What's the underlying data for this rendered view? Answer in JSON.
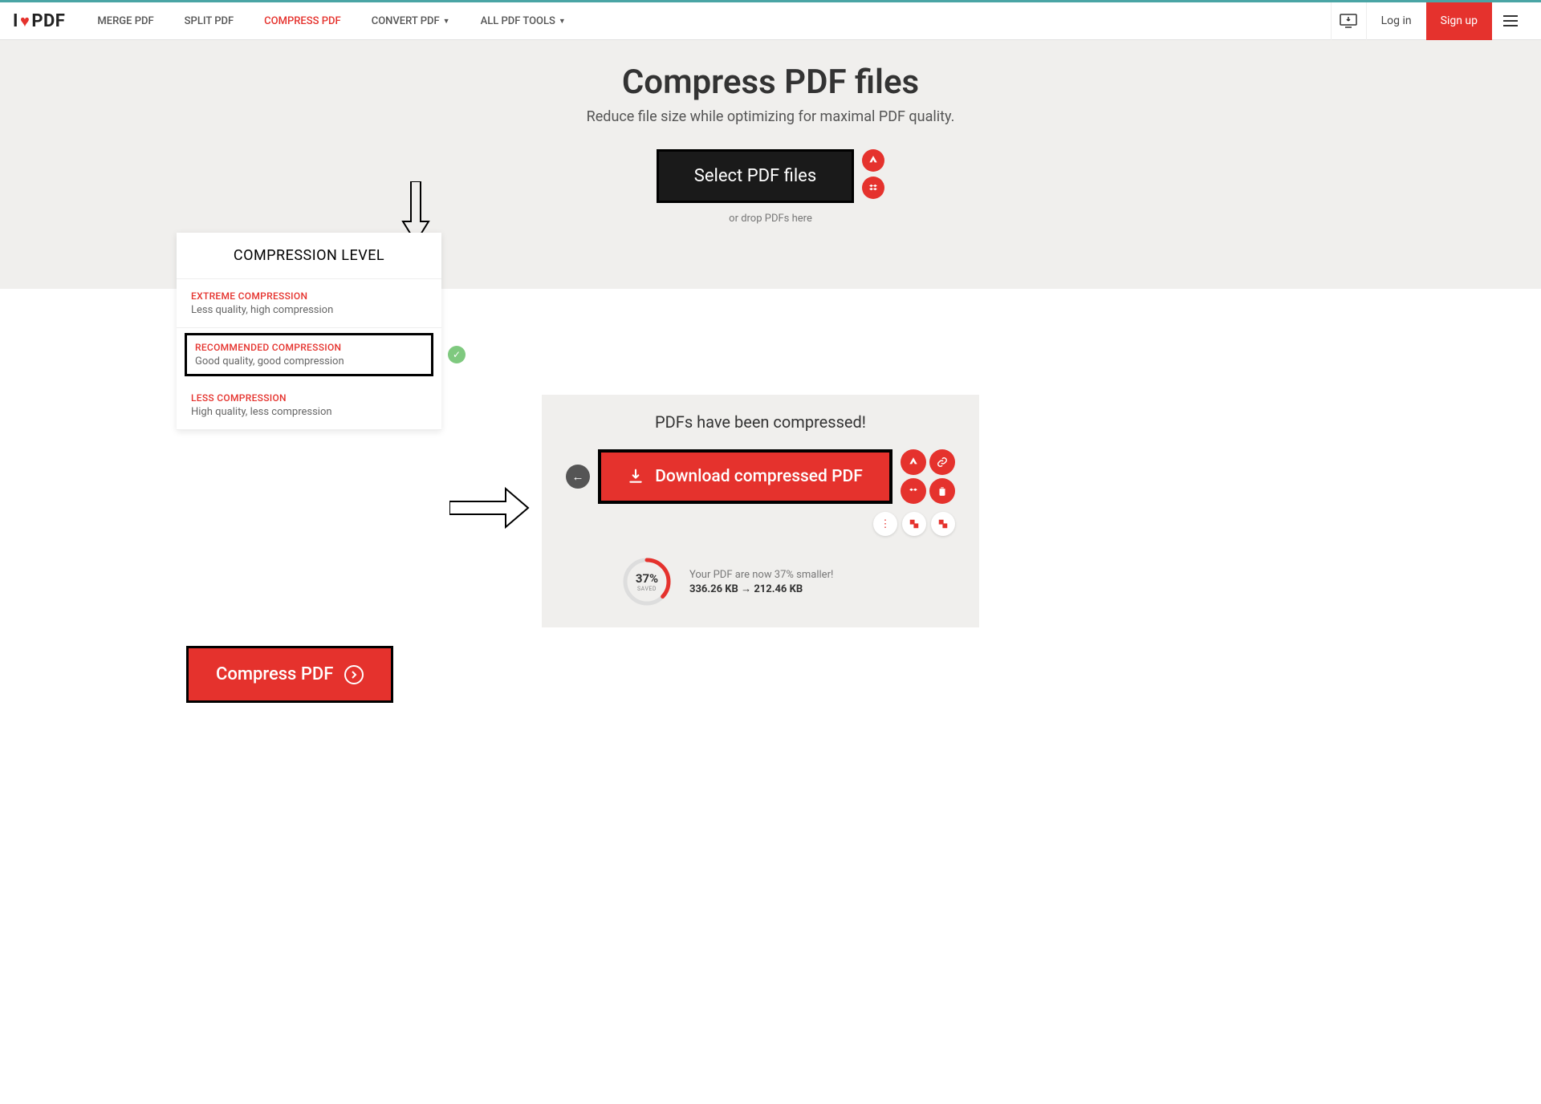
{
  "brand": {
    "pre": "I",
    "post": "PDF"
  },
  "nav": {
    "merge": "MERGE PDF",
    "split": "SPLIT PDF",
    "compress": "COMPRESS PDF",
    "convert": "CONVERT PDF",
    "all": "ALL PDF TOOLS"
  },
  "auth": {
    "login": "Log in",
    "signup": "Sign up"
  },
  "hero": {
    "title": "Compress PDF files",
    "subtitle": "Reduce file size while optimizing for maximal PDF quality.",
    "select_btn": "Select PDF files",
    "drop_hint": "or drop PDFs here"
  },
  "compression": {
    "title": "COMPRESSION LEVEL",
    "options": [
      {
        "name": "EXTREME COMPRESSION",
        "desc": "Less quality, high compression"
      },
      {
        "name": "RECOMMENDED COMPRESSION",
        "desc": "Good quality, good compression"
      },
      {
        "name": "LESS COMPRESSION",
        "desc": "High quality, less compression"
      }
    ]
  },
  "compress_action": "Compress PDF",
  "result": {
    "title": "PDFs have been compressed!",
    "download": "Download compressed PDF",
    "saved_pct": "37%",
    "saved_label": "SAVED",
    "smaller_text": "Your PDF are now 37% smaller!",
    "size_before": "336.26 KB",
    "size_after": "212.46 KB"
  }
}
